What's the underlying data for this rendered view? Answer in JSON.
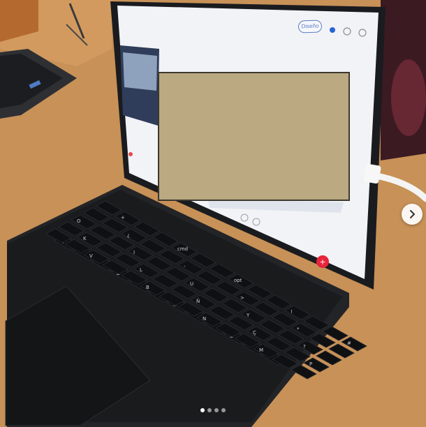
{
  "photo": {
    "screen_app": {
      "design_button_label": "Diseño"
    },
    "keyboard": {
      "keys": [
        "<",
        "Z",
        "X",
        "C",
        "V",
        "B",
        "N",
        "M",
        "K",
        "L",
        "Ñ",
        "Ç",
        "P",
        "O",
        "I",
        "U",
        "Y",
        "?",
        "¿",
        "-",
        ">",
        "*",
        "+",
        "cmd",
        "opt",
        "!",
        "#",
        "$",
        "%",
        "&",
        "/",
        "(",
        ")",
        "=",
        "^"
      ]
    },
    "redacted_region": {
      "color": "#baa981"
    }
  },
  "carousel": {
    "dots_total": 4,
    "active_index": 0
  },
  "icons": {
    "next": "chevron-right-icon",
    "fab": "plus-icon"
  }
}
